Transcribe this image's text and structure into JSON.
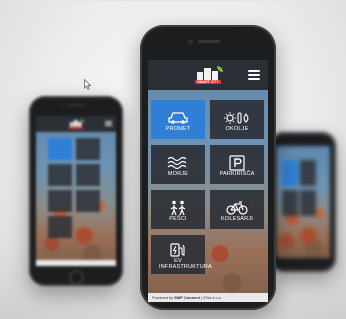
{
  "app": {
    "logo_text": "SMART CITY",
    "footer_prefix": "Powered by",
    "footer_brand": "SMP Connect",
    "footer_suffix": "| iPlot d.o.o."
  },
  "tiles": [
    {
      "label": "PROMET",
      "icon": "car-icon",
      "active": true
    },
    {
      "label": "OKOLJE",
      "icon": "weather-icon",
      "active": false
    },
    {
      "label": "MORJE",
      "icon": "waves-icon",
      "active": false
    },
    {
      "label": "PARKIRIŠČA",
      "icon": "parking-icon",
      "active": false
    },
    {
      "label": "PEŠCI",
      "icon": "pedestrians-icon",
      "active": false
    },
    {
      "label": "KOLESARJI",
      "icon": "bicycle-icon",
      "active": false
    },
    {
      "label": "EV INFRASTRUKTURA",
      "icon": "ev-charger-icon",
      "active": false
    }
  ],
  "colors": {
    "accent": "#2f7fd6",
    "tile": "#2b2f36",
    "brand_red": "#d9352b",
    "brand_green": "#7ac143"
  }
}
